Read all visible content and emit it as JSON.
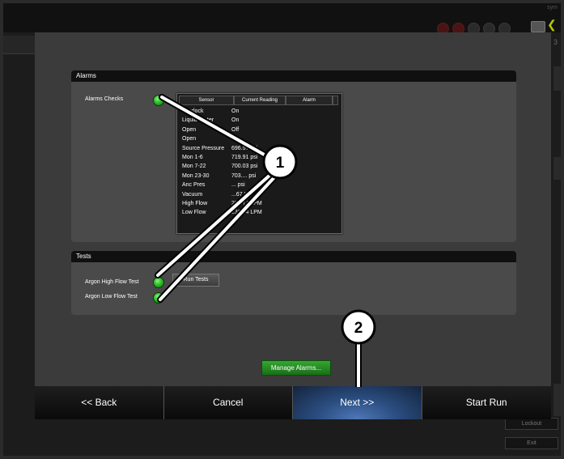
{
  "background": {
    "corner_text": "sym",
    "side_number": "3",
    "lower_buttons": [
      "Lockout",
      "Exit"
    ]
  },
  "alarms_section": {
    "title": "Alarms",
    "checks_label": "Alarms Checks",
    "status_color": "#33c42d"
  },
  "sensor_table": {
    "columns": [
      "Sensor",
      "Current Reading",
      "Alarm"
    ],
    "rows": [
      {
        "sensor": "Interlock",
        "reading": "On"
      },
      {
        "sensor": "Liquid Water",
        "reading": "On"
      },
      {
        "sensor": "Open",
        "reading": "Off"
      },
      {
        "sensor": "Open",
        "reading": ""
      },
      {
        "sensor": "Source Pressure",
        "reading": "696.57 psi"
      },
      {
        "sensor": "Mon 1-6",
        "reading": "719.91 psi"
      },
      {
        "sensor": "Mon 7-22",
        "reading": "700.03 psi"
      },
      {
        "sensor": "Mon 23-30",
        "reading": "703.... psi"
      },
      {
        "sensor": "Anc Pres",
        "reading": "... psi"
      },
      {
        "sensor": "Vacuum",
        "reading": "...67 Hg"
      },
      {
        "sensor": "High Flow",
        "reading": "233.74 LPM"
      },
      {
        "sensor": "Low Flow",
        "reading": "233.74 LPM"
      }
    ]
  },
  "tests_section": {
    "title": "Tests",
    "tests": [
      {
        "label": "Argon High Flow Test"
      },
      {
        "label": "Argon Low Flow Test"
      }
    ],
    "run_tests_label": "Run Tests"
  },
  "manage_alarms_label": "Manage Alarms...",
  "nav": {
    "back": "<< Back",
    "cancel": "Cancel",
    "next": "Next >>",
    "start_run": "Start Run"
  },
  "callouts": [
    "1",
    "2"
  ],
  "colors": {
    "dialog_bg": "#3b3b3b",
    "section_header": "#101010",
    "led_green": "#33c42d",
    "next_highlight": "#4f78b8",
    "manage_button": "#2a8f27"
  }
}
